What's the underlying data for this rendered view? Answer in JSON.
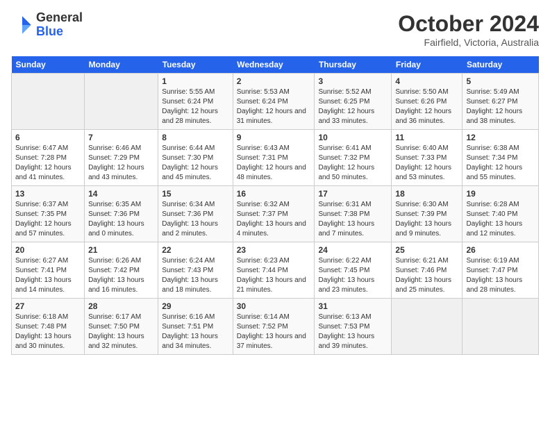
{
  "header": {
    "logo_general": "General",
    "logo_blue": "Blue",
    "title": "October 2024",
    "location": "Fairfield, Victoria, Australia"
  },
  "days_of_week": [
    "Sunday",
    "Monday",
    "Tuesday",
    "Wednesday",
    "Thursday",
    "Friday",
    "Saturday"
  ],
  "weeks": [
    [
      {
        "num": "",
        "sunrise": "",
        "sunset": "",
        "daylight": "",
        "empty": true
      },
      {
        "num": "",
        "sunrise": "",
        "sunset": "",
        "daylight": "",
        "empty": true
      },
      {
        "num": "1",
        "sunrise": "Sunrise: 5:55 AM",
        "sunset": "Sunset: 6:24 PM",
        "daylight": "Daylight: 12 hours and 28 minutes.",
        "empty": false
      },
      {
        "num": "2",
        "sunrise": "Sunrise: 5:53 AM",
        "sunset": "Sunset: 6:24 PM",
        "daylight": "Daylight: 12 hours and 31 minutes.",
        "empty": false
      },
      {
        "num": "3",
        "sunrise": "Sunrise: 5:52 AM",
        "sunset": "Sunset: 6:25 PM",
        "daylight": "Daylight: 12 hours and 33 minutes.",
        "empty": false
      },
      {
        "num": "4",
        "sunrise": "Sunrise: 5:50 AM",
        "sunset": "Sunset: 6:26 PM",
        "daylight": "Daylight: 12 hours and 36 minutes.",
        "empty": false
      },
      {
        "num": "5",
        "sunrise": "Sunrise: 5:49 AM",
        "sunset": "Sunset: 6:27 PM",
        "daylight": "Daylight: 12 hours and 38 minutes.",
        "empty": false
      }
    ],
    [
      {
        "num": "6",
        "sunrise": "Sunrise: 6:47 AM",
        "sunset": "Sunset: 7:28 PM",
        "daylight": "Daylight: 12 hours and 41 minutes.",
        "empty": false
      },
      {
        "num": "7",
        "sunrise": "Sunrise: 6:46 AM",
        "sunset": "Sunset: 7:29 PM",
        "daylight": "Daylight: 12 hours and 43 minutes.",
        "empty": false
      },
      {
        "num": "8",
        "sunrise": "Sunrise: 6:44 AM",
        "sunset": "Sunset: 7:30 PM",
        "daylight": "Daylight: 12 hours and 45 minutes.",
        "empty": false
      },
      {
        "num": "9",
        "sunrise": "Sunrise: 6:43 AM",
        "sunset": "Sunset: 7:31 PM",
        "daylight": "Daylight: 12 hours and 48 minutes.",
        "empty": false
      },
      {
        "num": "10",
        "sunrise": "Sunrise: 6:41 AM",
        "sunset": "Sunset: 7:32 PM",
        "daylight": "Daylight: 12 hours and 50 minutes.",
        "empty": false
      },
      {
        "num": "11",
        "sunrise": "Sunrise: 6:40 AM",
        "sunset": "Sunset: 7:33 PM",
        "daylight": "Daylight: 12 hours and 53 minutes.",
        "empty": false
      },
      {
        "num": "12",
        "sunrise": "Sunrise: 6:38 AM",
        "sunset": "Sunset: 7:34 PM",
        "daylight": "Daylight: 12 hours and 55 minutes.",
        "empty": false
      }
    ],
    [
      {
        "num": "13",
        "sunrise": "Sunrise: 6:37 AM",
        "sunset": "Sunset: 7:35 PM",
        "daylight": "Daylight: 12 hours and 57 minutes.",
        "empty": false
      },
      {
        "num": "14",
        "sunrise": "Sunrise: 6:35 AM",
        "sunset": "Sunset: 7:36 PM",
        "daylight": "Daylight: 13 hours and 0 minutes.",
        "empty": false
      },
      {
        "num": "15",
        "sunrise": "Sunrise: 6:34 AM",
        "sunset": "Sunset: 7:36 PM",
        "daylight": "Daylight: 13 hours and 2 minutes.",
        "empty": false
      },
      {
        "num": "16",
        "sunrise": "Sunrise: 6:32 AM",
        "sunset": "Sunset: 7:37 PM",
        "daylight": "Daylight: 13 hours and 4 minutes.",
        "empty": false
      },
      {
        "num": "17",
        "sunrise": "Sunrise: 6:31 AM",
        "sunset": "Sunset: 7:38 PM",
        "daylight": "Daylight: 13 hours and 7 minutes.",
        "empty": false
      },
      {
        "num": "18",
        "sunrise": "Sunrise: 6:30 AM",
        "sunset": "Sunset: 7:39 PM",
        "daylight": "Daylight: 13 hours and 9 minutes.",
        "empty": false
      },
      {
        "num": "19",
        "sunrise": "Sunrise: 6:28 AM",
        "sunset": "Sunset: 7:40 PM",
        "daylight": "Daylight: 13 hours and 12 minutes.",
        "empty": false
      }
    ],
    [
      {
        "num": "20",
        "sunrise": "Sunrise: 6:27 AM",
        "sunset": "Sunset: 7:41 PM",
        "daylight": "Daylight: 13 hours and 14 minutes.",
        "empty": false
      },
      {
        "num": "21",
        "sunrise": "Sunrise: 6:26 AM",
        "sunset": "Sunset: 7:42 PM",
        "daylight": "Daylight: 13 hours and 16 minutes.",
        "empty": false
      },
      {
        "num": "22",
        "sunrise": "Sunrise: 6:24 AM",
        "sunset": "Sunset: 7:43 PM",
        "daylight": "Daylight: 13 hours and 18 minutes.",
        "empty": false
      },
      {
        "num": "23",
        "sunrise": "Sunrise: 6:23 AM",
        "sunset": "Sunset: 7:44 PM",
        "daylight": "Daylight: 13 hours and 21 minutes.",
        "empty": false
      },
      {
        "num": "24",
        "sunrise": "Sunrise: 6:22 AM",
        "sunset": "Sunset: 7:45 PM",
        "daylight": "Daylight: 13 hours and 23 minutes.",
        "empty": false
      },
      {
        "num": "25",
        "sunrise": "Sunrise: 6:21 AM",
        "sunset": "Sunset: 7:46 PM",
        "daylight": "Daylight: 13 hours and 25 minutes.",
        "empty": false
      },
      {
        "num": "26",
        "sunrise": "Sunrise: 6:19 AM",
        "sunset": "Sunset: 7:47 PM",
        "daylight": "Daylight: 13 hours and 28 minutes.",
        "empty": false
      }
    ],
    [
      {
        "num": "27",
        "sunrise": "Sunrise: 6:18 AM",
        "sunset": "Sunset: 7:48 PM",
        "daylight": "Daylight: 13 hours and 30 minutes.",
        "empty": false
      },
      {
        "num": "28",
        "sunrise": "Sunrise: 6:17 AM",
        "sunset": "Sunset: 7:50 PM",
        "daylight": "Daylight: 13 hours and 32 minutes.",
        "empty": false
      },
      {
        "num": "29",
        "sunrise": "Sunrise: 6:16 AM",
        "sunset": "Sunset: 7:51 PM",
        "daylight": "Daylight: 13 hours and 34 minutes.",
        "empty": false
      },
      {
        "num": "30",
        "sunrise": "Sunrise: 6:14 AM",
        "sunset": "Sunset: 7:52 PM",
        "daylight": "Daylight: 13 hours and 37 minutes.",
        "empty": false
      },
      {
        "num": "31",
        "sunrise": "Sunrise: 6:13 AM",
        "sunset": "Sunset: 7:53 PM",
        "daylight": "Daylight: 13 hours and 39 minutes.",
        "empty": false
      },
      {
        "num": "",
        "sunrise": "",
        "sunset": "",
        "daylight": "",
        "empty": true
      },
      {
        "num": "",
        "sunrise": "",
        "sunset": "",
        "daylight": "",
        "empty": true
      }
    ]
  ]
}
